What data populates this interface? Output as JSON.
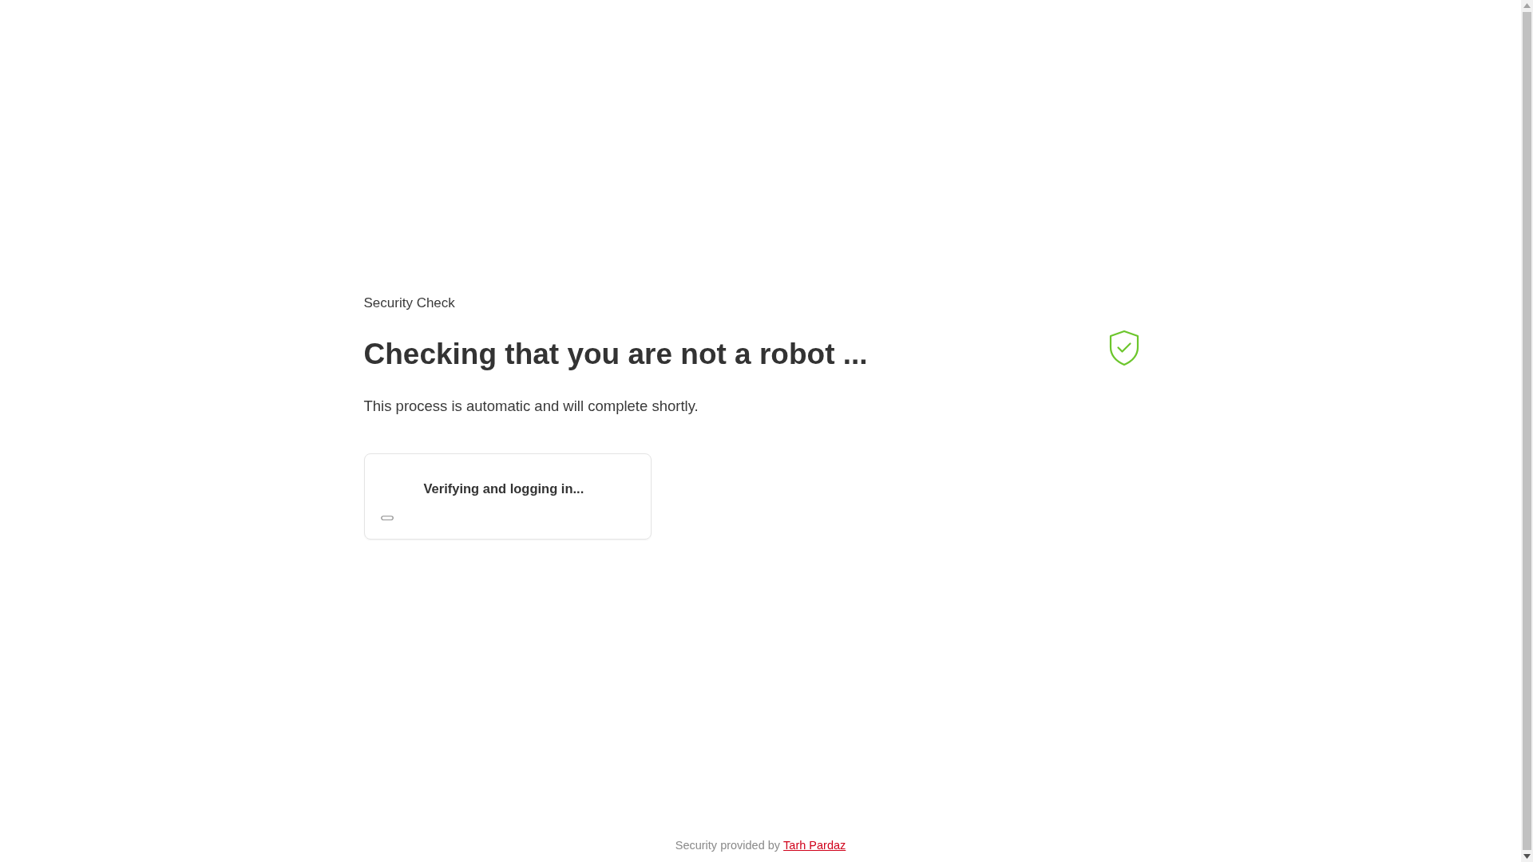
{
  "eyebrow": "Security Check",
  "heading": "Checking that you are not a robot ...",
  "description": "This process is automatic and will complete shortly.",
  "verification_card": {
    "message": "Verifying and logging in..."
  },
  "footer": {
    "text": "Security provided by",
    "link": "Tarh Pardaz"
  }
}
